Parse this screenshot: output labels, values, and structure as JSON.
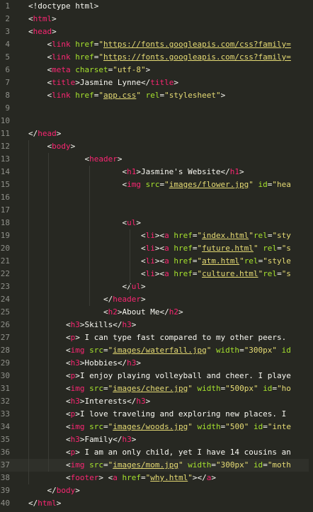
{
  "editor": {
    "line_numbers": [
      "1",
      "2",
      "3",
      "4",
      "5",
      "6",
      "7",
      "8",
      "9",
      "10",
      "11",
      "12",
      "13",
      "14",
      "15",
      "16",
      "17",
      "18",
      "19",
      "20",
      "21",
      "22",
      "23",
      "24",
      "25",
      "26",
      "27",
      "28",
      "29",
      "30",
      "31",
      "32",
      "33",
      "34",
      "35",
      "36",
      "37",
      "38",
      "39",
      "40"
    ],
    "active_line": 37,
    "lines": [
      [
        {
          "c": "p",
          "t": "<!doctype html>"
        }
      ],
      [
        {
          "c": "p",
          "t": "<"
        },
        {
          "c": "t",
          "t": "html"
        },
        {
          "c": "p",
          "t": ">"
        }
      ],
      [
        {
          "c": "p",
          "t": "<"
        },
        {
          "c": "t",
          "t": "head"
        },
        {
          "c": "p",
          "t": ">"
        }
      ],
      [
        {
          "c": "p",
          "t": "    <"
        },
        {
          "c": "t",
          "t": "link"
        },
        {
          "c": "p",
          "t": " "
        },
        {
          "c": "a",
          "t": "href"
        },
        {
          "c": "p",
          "t": "="
        },
        {
          "c": "s",
          "t": "\""
        },
        {
          "c": "u",
          "t": "https://fonts.googleapis.com/css?family="
        }
      ],
      [
        {
          "c": "p",
          "t": "    <"
        },
        {
          "c": "t",
          "t": "link"
        },
        {
          "c": "p",
          "t": " "
        },
        {
          "c": "a",
          "t": "href"
        },
        {
          "c": "p",
          "t": "="
        },
        {
          "c": "s",
          "t": "\""
        },
        {
          "c": "u",
          "t": "https://fonts.googleapis.com/css?family="
        }
      ],
      [
        {
          "c": "p",
          "t": "    <"
        },
        {
          "c": "t",
          "t": "meta"
        },
        {
          "c": "p",
          "t": " "
        },
        {
          "c": "a",
          "t": "charset"
        },
        {
          "c": "p",
          "t": "="
        },
        {
          "c": "s",
          "t": "\"utf-8\""
        },
        {
          "c": "p",
          "t": ">"
        }
      ],
      [
        {
          "c": "p",
          "t": "    <"
        },
        {
          "c": "t",
          "t": "title"
        },
        {
          "c": "p",
          "t": ">Jasmine Lynne</"
        },
        {
          "c": "t",
          "t": "title"
        },
        {
          "c": "p",
          "t": ">"
        }
      ],
      [
        {
          "c": "p",
          "t": "    <"
        },
        {
          "c": "t",
          "t": "link"
        },
        {
          "c": "p",
          "t": " "
        },
        {
          "c": "a",
          "t": "href"
        },
        {
          "c": "p",
          "t": "="
        },
        {
          "c": "s",
          "t": "\""
        },
        {
          "c": "u",
          "t": "app.css"
        },
        {
          "c": "s",
          "t": "\""
        },
        {
          "c": "p",
          "t": " "
        },
        {
          "c": "a",
          "t": "rel"
        },
        {
          "c": "p",
          "t": "="
        },
        {
          "c": "s",
          "t": "\"stylesheet\""
        },
        {
          "c": "p",
          "t": ">"
        }
      ],
      [],
      [],
      [
        {
          "c": "p",
          "t": "</"
        },
        {
          "c": "t",
          "t": "head"
        },
        {
          "c": "p",
          "t": ">"
        }
      ],
      [
        {
          "c": "p",
          "t": "    <"
        },
        {
          "c": "t",
          "t": "body"
        },
        {
          "c": "p",
          "t": ">"
        }
      ],
      [
        {
          "c": "p",
          "t": "            <"
        },
        {
          "c": "t",
          "t": "header"
        },
        {
          "c": "p",
          "t": ">"
        }
      ],
      [
        {
          "c": "p",
          "t": "                    <"
        },
        {
          "c": "t",
          "t": "h1"
        },
        {
          "c": "p",
          "t": ">Jasmine's Website</"
        },
        {
          "c": "t",
          "t": "h1"
        },
        {
          "c": "p",
          "t": ">"
        }
      ],
      [
        {
          "c": "p",
          "t": "                    <"
        },
        {
          "c": "t",
          "t": "img"
        },
        {
          "c": "p",
          "t": " "
        },
        {
          "c": "a",
          "t": "src"
        },
        {
          "c": "p",
          "t": "="
        },
        {
          "c": "s",
          "t": "\""
        },
        {
          "c": "u",
          "t": "images/flower.jpg"
        },
        {
          "c": "s",
          "t": "\""
        },
        {
          "c": "p",
          "t": " "
        },
        {
          "c": "a",
          "t": "id"
        },
        {
          "c": "p",
          "t": "="
        },
        {
          "c": "s",
          "t": "\"hea"
        }
      ],
      [],
      [],
      [
        {
          "c": "p",
          "t": "                    <"
        },
        {
          "c": "t",
          "t": "ul"
        },
        {
          "c": "p",
          "t": ">"
        }
      ],
      [
        {
          "c": "p",
          "t": "                        <"
        },
        {
          "c": "t",
          "t": "li"
        },
        {
          "c": "p",
          "t": "><"
        },
        {
          "c": "t",
          "t": "a"
        },
        {
          "c": "p",
          "t": " "
        },
        {
          "c": "a",
          "t": "href"
        },
        {
          "c": "p",
          "t": "="
        },
        {
          "c": "s",
          "t": "\""
        },
        {
          "c": "u",
          "t": "index.html"
        },
        {
          "c": "s",
          "t": "\""
        },
        {
          "c": "a",
          "t": "rel"
        },
        {
          "c": "p",
          "t": "="
        },
        {
          "c": "s",
          "t": "\"sty"
        }
      ],
      [
        {
          "c": "p",
          "t": "                        <"
        },
        {
          "c": "t",
          "t": "li"
        },
        {
          "c": "p",
          "t": "><"
        },
        {
          "c": "t",
          "t": "a"
        },
        {
          "c": "p",
          "t": " "
        },
        {
          "c": "a",
          "t": "href"
        },
        {
          "c": "p",
          "t": "="
        },
        {
          "c": "s",
          "t": "\""
        },
        {
          "c": "u",
          "t": "future.html"
        },
        {
          "c": "s",
          "t": "\""
        },
        {
          "c": "p",
          "t": " "
        },
        {
          "c": "a",
          "t": "rel"
        },
        {
          "c": "p",
          "t": "="
        },
        {
          "c": "s",
          "t": "\"s"
        }
      ],
      [
        {
          "c": "p",
          "t": "                        <"
        },
        {
          "c": "t",
          "t": "li"
        },
        {
          "c": "p",
          "t": "><"
        },
        {
          "c": "t",
          "t": "a"
        },
        {
          "c": "p",
          "t": " "
        },
        {
          "c": "a",
          "t": "href"
        },
        {
          "c": "p",
          "t": "="
        },
        {
          "c": "s",
          "t": "\""
        },
        {
          "c": "u",
          "t": "atm.html"
        },
        {
          "c": "s",
          "t": "\""
        },
        {
          "c": "a",
          "t": "rel"
        },
        {
          "c": "p",
          "t": "="
        },
        {
          "c": "s",
          "t": "\"style"
        }
      ],
      [
        {
          "c": "p",
          "t": "                        <"
        },
        {
          "c": "t",
          "t": "li"
        },
        {
          "c": "p",
          "t": "><"
        },
        {
          "c": "t",
          "t": "a"
        },
        {
          "c": "p",
          "t": " "
        },
        {
          "c": "a",
          "t": "href"
        },
        {
          "c": "p",
          "t": "="
        },
        {
          "c": "s",
          "t": "\""
        },
        {
          "c": "u",
          "t": "culture.html"
        },
        {
          "c": "s",
          "t": "\""
        },
        {
          "c": "a",
          "t": "rel"
        },
        {
          "c": "p",
          "t": "="
        },
        {
          "c": "s",
          "t": "\"s"
        }
      ],
      [
        {
          "c": "p",
          "t": "                    </"
        },
        {
          "c": "t",
          "t": "ul"
        },
        {
          "c": "p",
          "t": ">"
        }
      ],
      [
        {
          "c": "p",
          "t": "                </"
        },
        {
          "c": "t",
          "t": "header"
        },
        {
          "c": "p",
          "t": ">"
        }
      ],
      [
        {
          "c": "p",
          "t": "                <"
        },
        {
          "c": "t",
          "t": "h2"
        },
        {
          "c": "p",
          "t": ">About Me</"
        },
        {
          "c": "t",
          "t": "h2"
        },
        {
          "c": "p",
          "t": ">"
        }
      ],
      [
        {
          "c": "p",
          "t": "        <"
        },
        {
          "c": "t",
          "t": "h3"
        },
        {
          "c": "p",
          "t": ">Skills</"
        },
        {
          "c": "t",
          "t": "h3"
        },
        {
          "c": "p",
          "t": ">"
        }
      ],
      [
        {
          "c": "p",
          "t": "        <"
        },
        {
          "c": "t",
          "t": "p"
        },
        {
          "c": "p",
          "t": "> I can type fast compared to my other peers."
        }
      ],
      [
        {
          "c": "p",
          "t": "        <"
        },
        {
          "c": "t",
          "t": "img"
        },
        {
          "c": "p",
          "t": " "
        },
        {
          "c": "a",
          "t": "src"
        },
        {
          "c": "p",
          "t": "="
        },
        {
          "c": "s",
          "t": "\""
        },
        {
          "c": "u",
          "t": "images/waterfall.jpg"
        },
        {
          "c": "s",
          "t": "\""
        },
        {
          "c": "p",
          "t": " "
        },
        {
          "c": "a",
          "t": "width"
        },
        {
          "c": "p",
          "t": "="
        },
        {
          "c": "s",
          "t": "\"300px\""
        },
        {
          "c": "p",
          "t": " "
        },
        {
          "c": "a",
          "t": "id"
        }
      ],
      [
        {
          "c": "p",
          "t": "        <"
        },
        {
          "c": "t",
          "t": "h3"
        },
        {
          "c": "p",
          "t": ">Hobbies</"
        },
        {
          "c": "t",
          "t": "h3"
        },
        {
          "c": "p",
          "t": ">"
        }
      ],
      [
        {
          "c": "p",
          "t": "        <"
        },
        {
          "c": "t",
          "t": "p"
        },
        {
          "c": "p",
          "t": ">I enjoy playing volleyball and cheer. I playe"
        }
      ],
      [
        {
          "c": "p",
          "t": "        <"
        },
        {
          "c": "t",
          "t": "img"
        },
        {
          "c": "p",
          "t": " "
        },
        {
          "c": "a",
          "t": "src"
        },
        {
          "c": "p",
          "t": "="
        },
        {
          "c": "s",
          "t": "\""
        },
        {
          "c": "u",
          "t": "images/cheer.jpg"
        },
        {
          "c": "s",
          "t": "\""
        },
        {
          "c": "p",
          "t": " "
        },
        {
          "c": "a",
          "t": "width"
        },
        {
          "c": "p",
          "t": "="
        },
        {
          "c": "s",
          "t": "\"500px\""
        },
        {
          "c": "p",
          "t": " "
        },
        {
          "c": "a",
          "t": "id"
        },
        {
          "c": "p",
          "t": "="
        },
        {
          "c": "s",
          "t": "\"ho"
        }
      ],
      [
        {
          "c": "p",
          "t": "        <"
        },
        {
          "c": "t",
          "t": "h3"
        },
        {
          "c": "p",
          "t": ">Interests</"
        },
        {
          "c": "t",
          "t": "h3"
        },
        {
          "c": "p",
          "t": ">"
        }
      ],
      [
        {
          "c": "p",
          "t": "        <"
        },
        {
          "c": "t",
          "t": "p"
        },
        {
          "c": "p",
          "t": ">I love traveling and exploring new places. I"
        }
      ],
      [
        {
          "c": "p",
          "t": "        <"
        },
        {
          "c": "t",
          "t": "img"
        },
        {
          "c": "p",
          "t": " "
        },
        {
          "c": "a",
          "t": "src"
        },
        {
          "c": "p",
          "t": "="
        },
        {
          "c": "s",
          "t": "\""
        },
        {
          "c": "u",
          "t": "images/woods.jpg"
        },
        {
          "c": "s",
          "t": "\""
        },
        {
          "c": "p",
          "t": " "
        },
        {
          "c": "a",
          "t": "width"
        },
        {
          "c": "p",
          "t": "="
        },
        {
          "c": "s",
          "t": "\"500\""
        },
        {
          "c": "p",
          "t": " "
        },
        {
          "c": "a",
          "t": "id"
        },
        {
          "c": "p",
          "t": "="
        },
        {
          "c": "s",
          "t": "\"inte"
        }
      ],
      [
        {
          "c": "p",
          "t": "        <"
        },
        {
          "c": "t",
          "t": "h3"
        },
        {
          "c": "p",
          "t": ">Family</"
        },
        {
          "c": "t",
          "t": "h3"
        },
        {
          "c": "p",
          "t": ">"
        }
      ],
      [
        {
          "c": "p",
          "t": "        <"
        },
        {
          "c": "t",
          "t": "p"
        },
        {
          "c": "p",
          "t": "> I am an only child, yet I have 14 cousins an"
        }
      ],
      [
        {
          "c": "p",
          "t": "        <"
        },
        {
          "c": "t",
          "t": "img"
        },
        {
          "c": "p",
          "t": " "
        },
        {
          "c": "a",
          "t": "src"
        },
        {
          "c": "p",
          "t": "="
        },
        {
          "c": "s",
          "t": "\""
        },
        {
          "c": "u",
          "t": "images/mom.jpg"
        },
        {
          "c": "s",
          "t": "\""
        },
        {
          "c": "p",
          "t": " "
        },
        {
          "c": "a",
          "t": "width"
        },
        {
          "c": "p",
          "t": "="
        },
        {
          "c": "s",
          "t": "\"300px\""
        },
        {
          "c": "p",
          "t": " "
        },
        {
          "c": "a",
          "t": "id"
        },
        {
          "c": "p",
          "t": "="
        },
        {
          "c": "s",
          "t": "\"moth"
        }
      ],
      [
        {
          "c": "p",
          "t": "        <"
        },
        {
          "c": "t",
          "t": "footer"
        },
        {
          "c": "p",
          "t": "> <"
        },
        {
          "c": "t",
          "t": "a"
        },
        {
          "c": "p",
          "t": " "
        },
        {
          "c": "a",
          "t": "href"
        },
        {
          "c": "p",
          "t": "="
        },
        {
          "c": "s",
          "t": "\""
        },
        {
          "c": "u",
          "t": "why.html"
        },
        {
          "c": "s",
          "t": "\""
        },
        {
          "c": "p",
          "t": "></"
        },
        {
          "c": "t",
          "t": "a"
        },
        {
          "c": "p",
          "t": ">"
        }
      ],
      [
        {
          "c": "p",
          "t": "    </"
        },
        {
          "c": "t",
          "t": "body"
        },
        {
          "c": "p",
          "t": ">"
        }
      ],
      [
        {
          "c": "p",
          "t": "</"
        },
        {
          "c": "t",
          "t": "html"
        },
        {
          "c": "p",
          "t": ">"
        }
      ]
    ]
  },
  "colors": {
    "background": "#272822",
    "tag": "#f92672",
    "attribute": "#a6e22e",
    "string": "#e6db74",
    "text": "#f8f8f2",
    "line_number": "#8f908a"
  }
}
